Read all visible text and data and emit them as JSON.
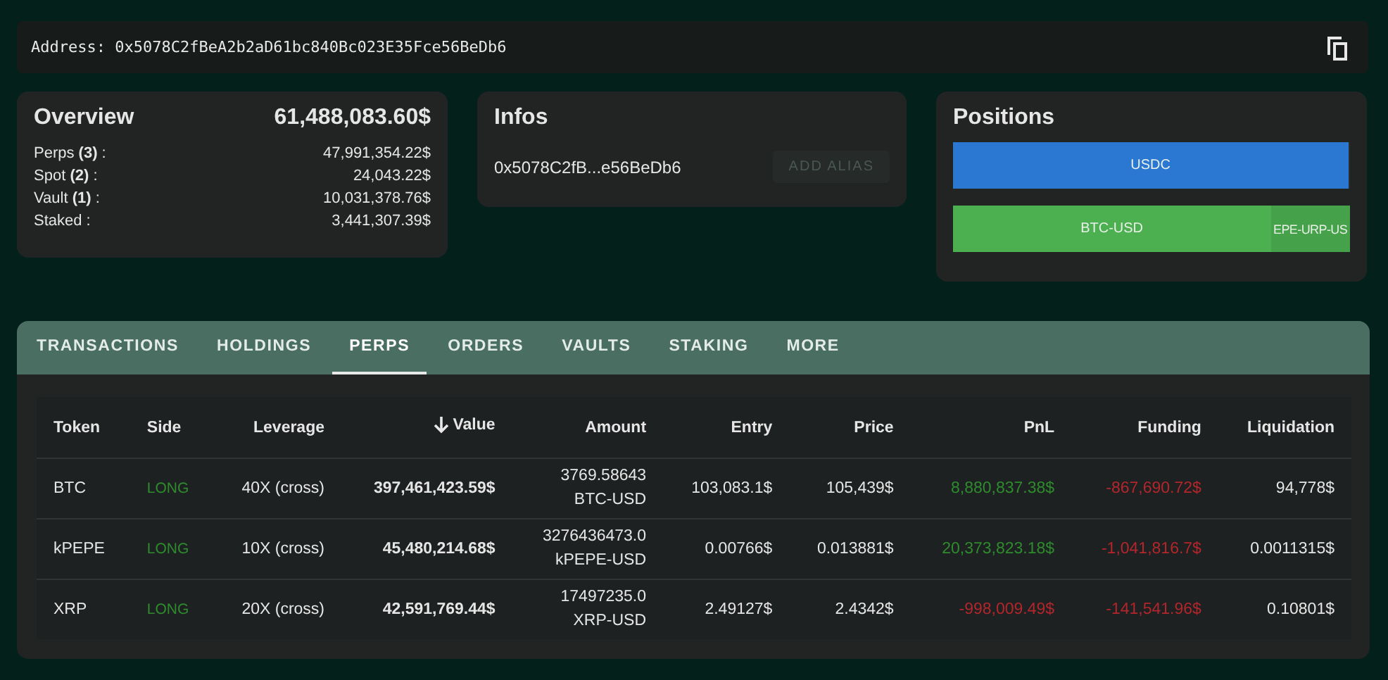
{
  "address": {
    "label": "Address:",
    "value": "0x5078C2fBeA2b2aD61bc840Bc023E35Fce56BeDb6"
  },
  "overview": {
    "title": "Overview",
    "total": "61,488,083.60$",
    "rows": [
      {
        "label": "Perps **(3)** :",
        "value": "47,991,354.22$"
      },
      {
        "label": "Spot **(2)** :",
        "value": "24,043.22$"
      },
      {
        "label": "Vault **(1)** :",
        "value": "10,031,378.76$"
      },
      {
        "label": "Staked :",
        "value": "3,441,307.39$"
      }
    ]
  },
  "infos": {
    "title": "Infos",
    "address": "0x5078C2fB...e56BeDb6",
    "button": {
      "label": "ADD ALIAS",
      "disabled": true
    }
  },
  "positions": {
    "title": "Positions",
    "bars": [
      {
        "label": "USDC",
        "color": "#2a78d2",
        "level": 0.995
      },
      {
        "label": "BTC-USD",
        "color": "#4caf50",
        "level": 0.8,
        "rest_label": "EPE-URP-US"
      }
    ]
  },
  "tabs": [
    {
      "label": "TRANSACTIONS",
      "selected": false
    },
    {
      "label": "HOLDINGS",
      "selected": false
    },
    {
      "label": "PERPS",
      "selected": true
    },
    {
      "label": "ORDERS",
      "selected": false
    },
    {
      "label": "VAULTS",
      "selected": false
    },
    {
      "label": "STAKING",
      "selected": false
    },
    {
      "label": "MORE",
      "selected": false
    }
  ],
  "table": {
    "columns": [
      {
        "label": "Token",
        "sorted": false
      },
      {
        "label": "Side",
        "sorted": false
      },
      {
        "label": "Leverage",
        "sorted": false
      },
      {
        "label": "Value",
        "sorted": true
      },
      {
        "label": "Amount",
        "sorted": false
      },
      {
        "label": "Entry",
        "sorted": false
      },
      {
        "label": "Price",
        "sorted": false
      },
      {
        "label": "PnL",
        "sorted": false
      },
      {
        "label": "Funding",
        "sorted": false
      },
      {
        "label": "Liquidation",
        "sorted": false
      }
    ],
    "rows": [
      {
        "token": "BTC",
        "side": "LONG",
        "leverage": "40X (cross)",
        "value": "397,461,423.59$",
        "amount": "3769.58643",
        "pair": "BTC-USD",
        "entry": "103,083.1$",
        "price": "105,439$",
        "pnl": "8,880,837.38$",
        "pnl_positive": true,
        "funding": "-867,690.72$",
        "funding_positive": false,
        "liquidation": "94,778$"
      },
      {
        "token": "kPEPE",
        "side": "LONG",
        "leverage": "10X (cross)",
        "value": "45,480,214.68$",
        "amount": "3276436473.0",
        "pair": "kPEPE-USD",
        "entry": "0.00766$",
        "price": "0.013881$",
        "pnl": "20,373,823.18$",
        "pnl_positive": true,
        "funding": "-1,041,816.7$",
        "funding_positive": false,
        "liquidation": "0.0011315$"
      },
      {
        "token": "XRP",
        "side": "LONG",
        "leverage": "20X (cross)",
        "value": "42,591,769.44$",
        "amount": "17497235.0",
        "pair": "XRP-USD",
        "entry": "2.49127$",
        "price": "2.4342$",
        "pnl": "-998,009.49$",
        "pnl_positive": false,
        "funding": "-141,541.96$",
        "funding_positive": false,
        "liquidation": "0.10801$"
      }
    ]
  }
}
